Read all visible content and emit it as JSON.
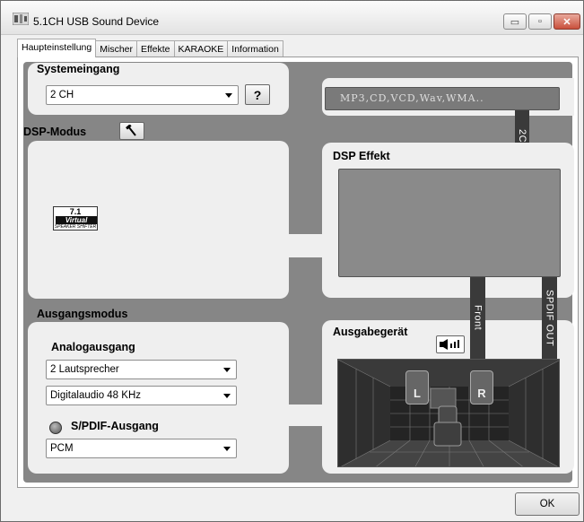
{
  "window": {
    "title": "5.1CH USB Sound Device"
  },
  "tabs": [
    {
      "label": "Haupteinstellung"
    },
    {
      "label": "Mischer"
    },
    {
      "label": "Effekte"
    },
    {
      "label": "KARAOKE"
    },
    {
      "label": "Information"
    }
  ],
  "system_input": {
    "title": "Systemeingang",
    "value": "2 CH",
    "help_label": "?",
    "formats": "MP3,CD,VCD,Wav,WMA..",
    "bar_label": "2CH"
  },
  "dsp_mode": {
    "title": "DSP-Modus",
    "logo": {
      "line1": "7.1",
      "line2": "Virtual",
      "line3": "SPEAKER SHIFTER"
    }
  },
  "dsp_effect": {
    "title": "DSP Effekt"
  },
  "output_mode": {
    "title": "Ausgangsmodus",
    "analog_title": "Analogausgang",
    "speakers_value": "2 Lautsprecher",
    "digital_value": "Digitalaudio  48 KHz",
    "spdif_title": "S/PDIF-Ausgang",
    "pcm_value": "PCM"
  },
  "output_device": {
    "title": "Ausgabegerät",
    "front_label": "Front",
    "spdif_out_label": "SPDIF OUT",
    "speaker_left": "L",
    "speaker_right": "R"
  },
  "footer": {
    "ok_label": "OK"
  },
  "icons": {
    "app": "speaker-app-icon",
    "hammer": "hammer-icon",
    "speaker_test": "speaker-level-icon",
    "spdif": "spdif-toggle-icon"
  }
}
